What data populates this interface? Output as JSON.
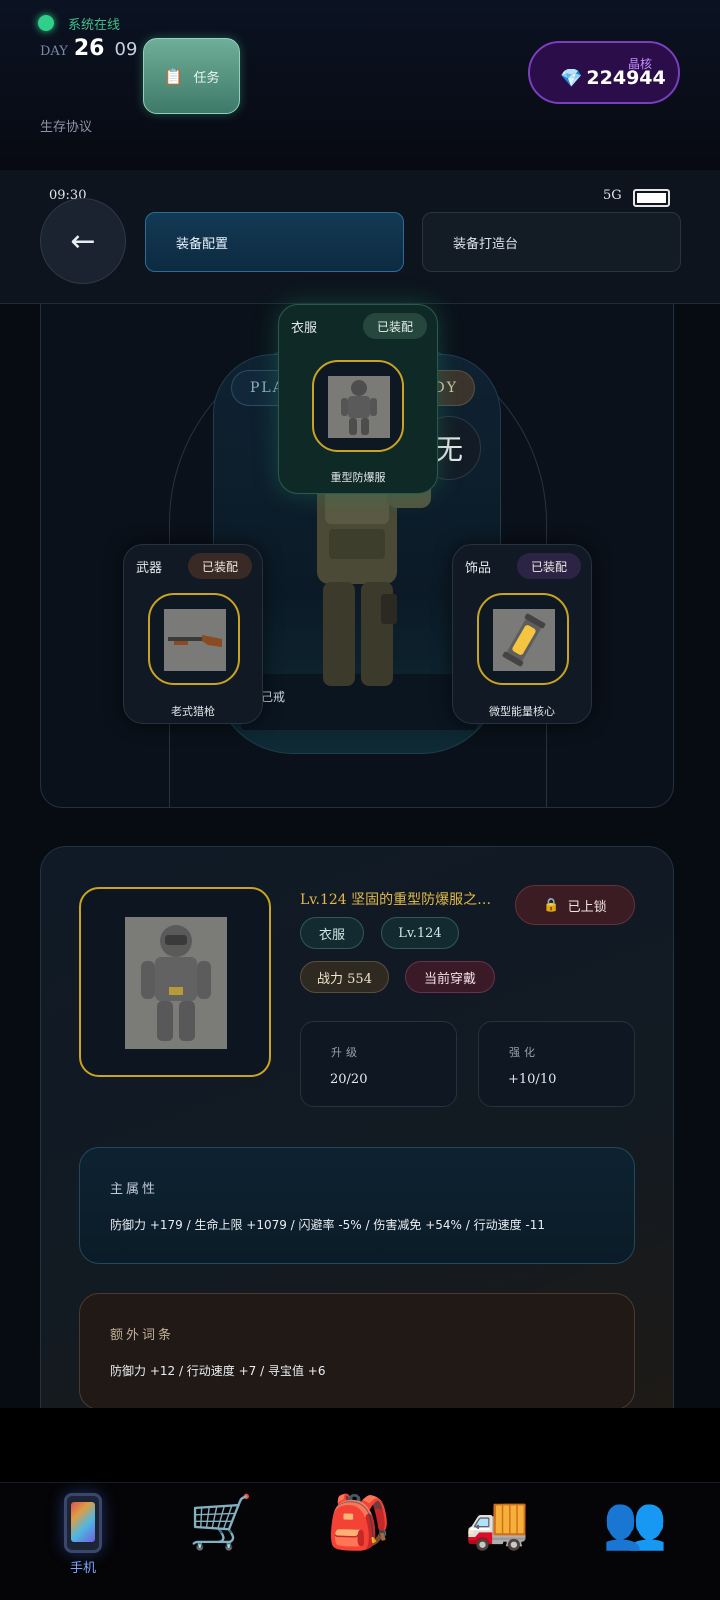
{
  "status": {
    "online_text": "系统在线",
    "day_label": "DAY",
    "day_number": "26",
    "day_sub": "09",
    "protocol": "生存协议"
  },
  "task_button": {
    "icon": "clipboard-icon",
    "label": "任务"
  },
  "currency": {
    "label": "晶核",
    "icon": "diamond-icon",
    "value": "224944"
  },
  "subheader": {
    "time": "09:30",
    "network": "5G",
    "battery_level": 1.0,
    "back_icon": "←",
    "tabs": [
      {
        "label": "装备配置",
        "active": true
      },
      {
        "label": "装备打造台",
        "active": false
      }
    ]
  },
  "character": {
    "pill_left": "PLA",
    "pill_right": "ADY",
    "none_label": "无",
    "ring_label": "己戒",
    "slots": {
      "clothes": {
        "title": "衣服",
        "badge": "已装配",
        "name": "重型防爆服"
      },
      "weapon": {
        "title": "武器",
        "badge": "已装配",
        "name": "老式猎枪"
      },
      "accessory": {
        "title": "饰品",
        "badge": "已装配",
        "name": "微型能量核心"
      }
    }
  },
  "detail": {
    "title": "Lv.124 坚固的重型防爆服之…",
    "lock_icon": "🔒",
    "lock_label": "已上锁",
    "type_chip": "衣服",
    "level_chip": "Lv.124",
    "power_chip": "战力 554",
    "wearing_chip": "当前穿戴",
    "upgrade": {
      "label": "升级",
      "value": "20/20"
    },
    "enhance": {
      "label": "强化",
      "value": "+10/10"
    },
    "main_attr": {
      "title": "主属性",
      "text": "防御力 +179 / 生命上限 +1079 / 闪避率 -5% / 伤害减免 +54% / 行动速度 -11"
    },
    "extra_attr": {
      "title": "额外词条",
      "text": "防御力 +12 / 行动速度 +7 / 寻宝值 +6"
    }
  },
  "bottom_nav": [
    {
      "icon": "phone-icon",
      "label": "手机",
      "active": true
    },
    {
      "icon": "cart-icon",
      "glyph": "🛒",
      "label": ""
    },
    {
      "icon": "backpack-icon",
      "glyph": "🎒",
      "label": ""
    },
    {
      "icon": "truck-icon",
      "glyph": "🚚",
      "label": ""
    },
    {
      "icon": "people-icon",
      "glyph": "👥",
      "label": ""
    }
  ]
}
